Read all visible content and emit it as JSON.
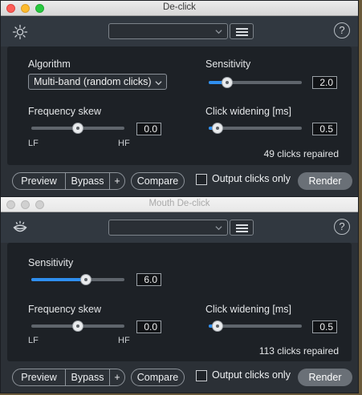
{
  "declick": {
    "title": "De-click",
    "logo_icon": "sun-icon",
    "preset_value": "",
    "algorithm": {
      "label": "Algorithm",
      "value": "Multi-band (random clicks)"
    },
    "sensitivity": {
      "label": "Sensitivity",
      "value": "2.0",
      "level": 0.16
    },
    "frequency_skew": {
      "label": "Frequency skew",
      "value": "0.0",
      "level": 0.5,
      "min_label": "LF",
      "max_label": "HF"
    },
    "click_widening": {
      "label": "Click widening [ms]",
      "value": "0.5",
      "level": 0.05
    },
    "status": "49 clicks repaired",
    "footer": {
      "preview": "Preview",
      "bypass": "Bypass",
      "plus": "+",
      "compare": "Compare",
      "output_clicks_only": "Output clicks only",
      "render": "Render"
    }
  },
  "mouth_declick": {
    "title": "Mouth De-click",
    "logo_icon": "mouth-icon",
    "preset_value": "",
    "sensitivity": {
      "label": "Sensitivity",
      "value": "6.0",
      "level": 0.6
    },
    "frequency_skew": {
      "label": "Frequency skew",
      "value": "0.0",
      "level": 0.5,
      "min_label": "LF",
      "max_label": "HF"
    },
    "click_widening": {
      "label": "Click widening [ms]",
      "value": "0.5",
      "level": 0.05
    },
    "status": "113 clicks repaired",
    "footer": {
      "preview": "Preview",
      "bypass": "Bypass",
      "plus": "+",
      "compare": "Compare",
      "output_clicks_only": "Output clicks only",
      "render": "Render"
    }
  },
  "colors": {
    "accent": "#2f8ff0",
    "panel": "#1d2126",
    "chrome": "#2b3036",
    "render_button": "#6a7077"
  }
}
